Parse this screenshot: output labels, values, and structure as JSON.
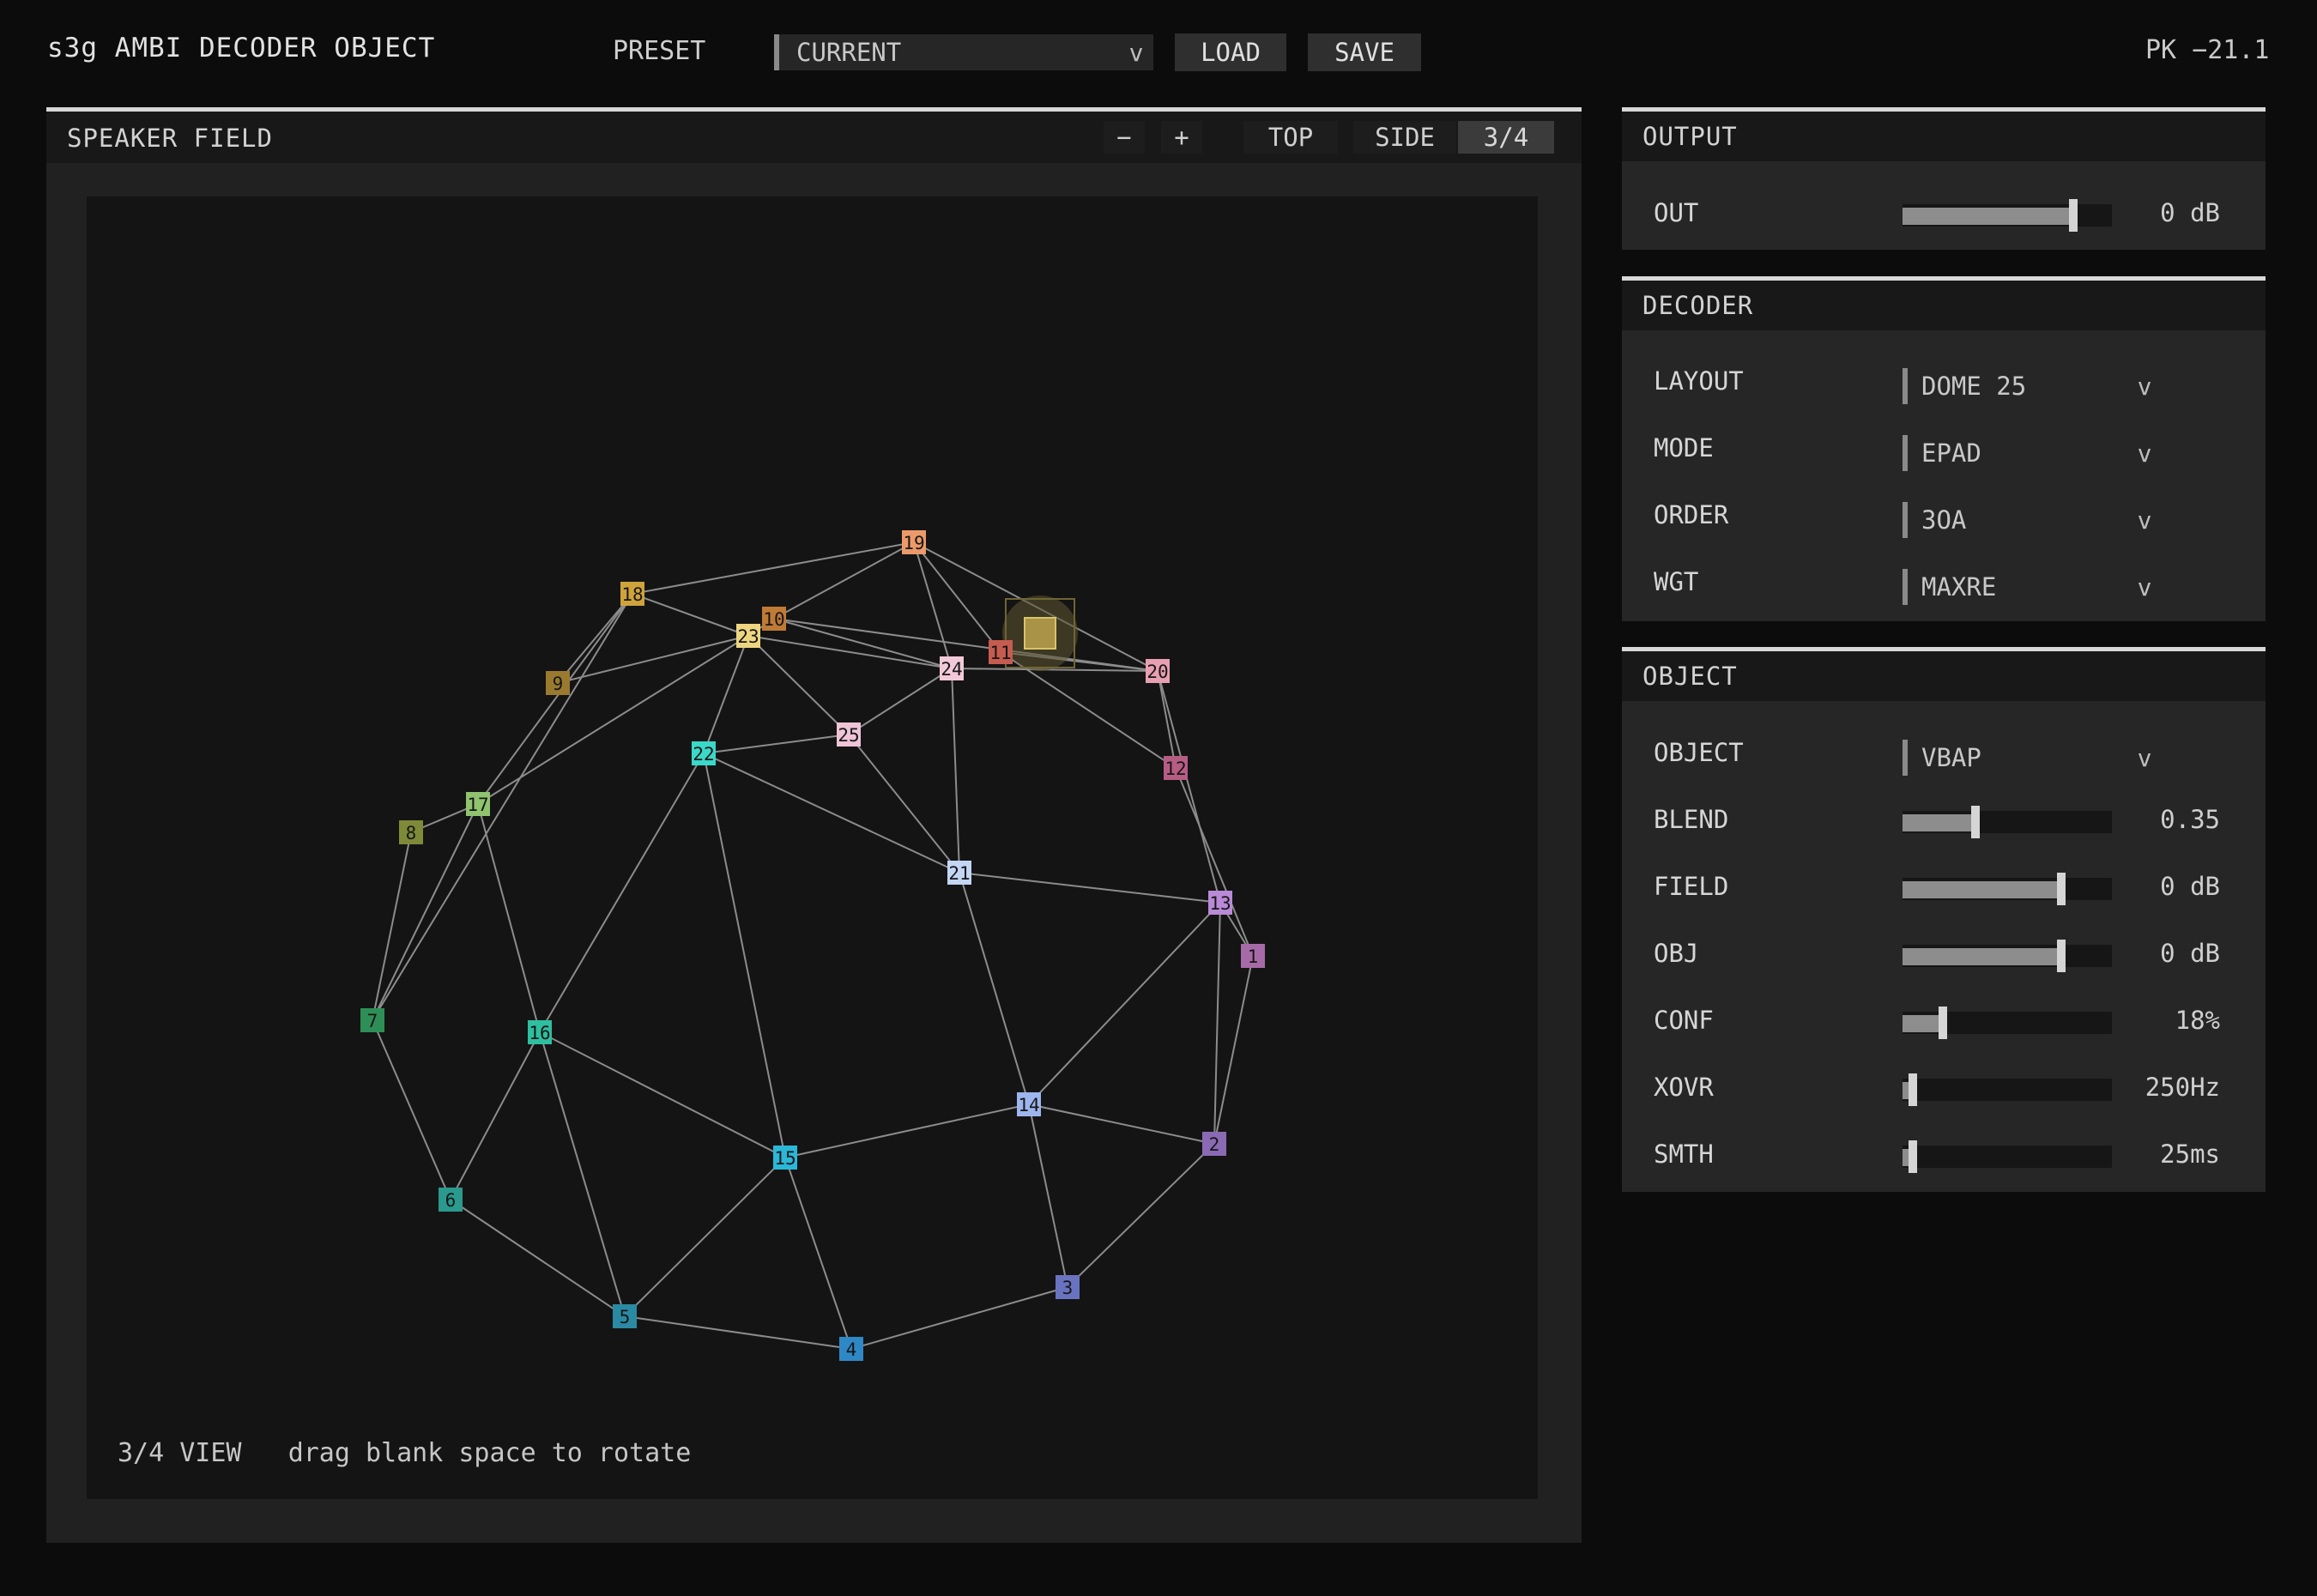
{
  "header": {
    "title": "s3g AMBI DECODER OBJECT",
    "preset_label": "PRESET",
    "preset_value": "CURRENT",
    "load_label": "LOAD",
    "save_label": "SAVE",
    "peak": "PK −21.1"
  },
  "field": {
    "title": "SPEAKER FIELD",
    "buttons": {
      "zoom_out": "−",
      "zoom_in": "+",
      "top": "TOP",
      "side": "SIDE",
      "three_quarter": "3/4"
    },
    "active_view": "3/4",
    "status_view": "3/4 VIEW",
    "status_hint": "drag blank space to rotate",
    "speakers": [
      {
        "id": "1",
        "color": "#a76aa8"
      },
      {
        "id": "2",
        "color": "#8a6ab4"
      },
      {
        "id": "3",
        "color": "#6a73bf"
      },
      {
        "id": "4",
        "color": "#2f88c6"
      },
      {
        "id": "5",
        "color": "#2a8aa3"
      },
      {
        "id": "6",
        "color": "#2a9a8e"
      },
      {
        "id": "7",
        "color": "#2d8f57"
      },
      {
        "id": "8",
        "color": "#7e8a37"
      },
      {
        "id": "9",
        "color": "#9a7a2e"
      },
      {
        "id": "10",
        "color": "#bf7a35"
      },
      {
        "id": "11",
        "color": "#c65b4f"
      },
      {
        "id": "12",
        "color": "#b65d84"
      },
      {
        "id": "13",
        "color": "#b98ad8"
      },
      {
        "id": "14",
        "color": "#9db6ee"
      },
      {
        "id": "15",
        "color": "#2ab8d8"
      },
      {
        "id": "16",
        "color": "#2dbfa0"
      },
      {
        "id": "17",
        "color": "#8fc36e"
      },
      {
        "id": "18",
        "color": "#cfa33a"
      },
      {
        "id": "19",
        "color": "#ec9a6a"
      },
      {
        "id": "20",
        "color": "#e89fb2"
      },
      {
        "id": "21",
        "color": "#c3d6f3"
      },
      {
        "id": "22",
        "color": "#3ad8c8"
      },
      {
        "id": "23",
        "color": "#eed681"
      },
      {
        "id": "24",
        "color": "#f1c9d8"
      },
      {
        "id": "25",
        "color": "#efc4d7"
      }
    ],
    "edges": [
      [
        "18",
        "19"
      ],
      [
        "19",
        "10"
      ],
      [
        "19",
        "11"
      ],
      [
        "19",
        "24"
      ],
      [
        "19",
        "20"
      ],
      [
        "18",
        "23"
      ],
      [
        "18",
        "17"
      ],
      [
        "18",
        "9"
      ],
      [
        "18",
        "7"
      ],
      [
        "23",
        "10"
      ],
      [
        "10",
        "24"
      ],
      [
        "10",
        "20"
      ],
      [
        "23",
        "24"
      ],
      [
        "23",
        "9"
      ],
      [
        "23",
        "17"
      ],
      [
        "23",
        "22"
      ],
      [
        "23",
        "25"
      ],
      [
        "24",
        "25"
      ],
      [
        "24",
        "21"
      ],
      [
        "24",
        "20"
      ],
      [
        "11",
        "20"
      ],
      [
        "11",
        "12"
      ],
      [
        "20",
        "12"
      ],
      [
        "20",
        "13"
      ],
      [
        "12",
        "1"
      ],
      [
        "25",
        "22"
      ],
      [
        "25",
        "21"
      ],
      [
        "22",
        "21"
      ],
      [
        "21",
        "13"
      ],
      [
        "21",
        "14"
      ],
      [
        "22",
        "16"
      ],
      [
        "22",
        "15"
      ],
      [
        "13",
        "1"
      ],
      [
        "13",
        "2"
      ],
      [
        "13",
        "14"
      ],
      [
        "1",
        "2"
      ],
      [
        "17",
        "8"
      ],
      [
        "17",
        "7"
      ],
      [
        "17",
        "16"
      ],
      [
        "8",
        "7"
      ],
      [
        "7",
        "6"
      ],
      [
        "16",
        "6"
      ],
      [
        "16",
        "5"
      ],
      [
        "16",
        "15"
      ],
      [
        "15",
        "14"
      ],
      [
        "15",
        "5"
      ],
      [
        "15",
        "4"
      ],
      [
        "14",
        "2"
      ],
      [
        "14",
        "3"
      ],
      [
        "6",
        "5"
      ],
      [
        "5",
        "4"
      ],
      [
        "4",
        "3"
      ],
      [
        "3",
        "2"
      ]
    ],
    "object_marker": "source-object"
  },
  "output": {
    "title": "OUTPUT",
    "rows": [
      {
        "label": "OUT",
        "value": "0 dB",
        "level": 0.83
      }
    ]
  },
  "decoder": {
    "title": "DECODER",
    "rows": [
      {
        "label": "LAYOUT",
        "value": "DOME 25"
      },
      {
        "label": "MODE",
        "value": "EPAD"
      },
      {
        "label": "ORDER",
        "value": "3OA"
      },
      {
        "label": "WGT",
        "value": "MAXRE"
      }
    ]
  },
  "object": {
    "title": "OBJECT",
    "object_row": {
      "label": "OBJECT",
      "value": "VBAP"
    },
    "rows": [
      {
        "label": "BLEND",
        "value": "0.35",
        "level": 0.34
      },
      {
        "label": "FIELD",
        "value": "0 dB",
        "level": 0.77
      },
      {
        "label": "OBJ",
        "value": "0 dB",
        "level": 0.77
      },
      {
        "label": "CONF",
        "value": "18%",
        "level": 0.18
      },
      {
        "label": "XOVR",
        "value": "250Hz",
        "level": 0.03
      },
      {
        "label": "SMTH",
        "value": "25ms",
        "level": 0.03
      }
    ]
  },
  "colors": {
    "accent_rule": "#d8d8d8",
    "edge": "#8c8c8c",
    "object_marker": "#a89346"
  },
  "icons": {
    "dropdown": "chevron-down-icon"
  }
}
